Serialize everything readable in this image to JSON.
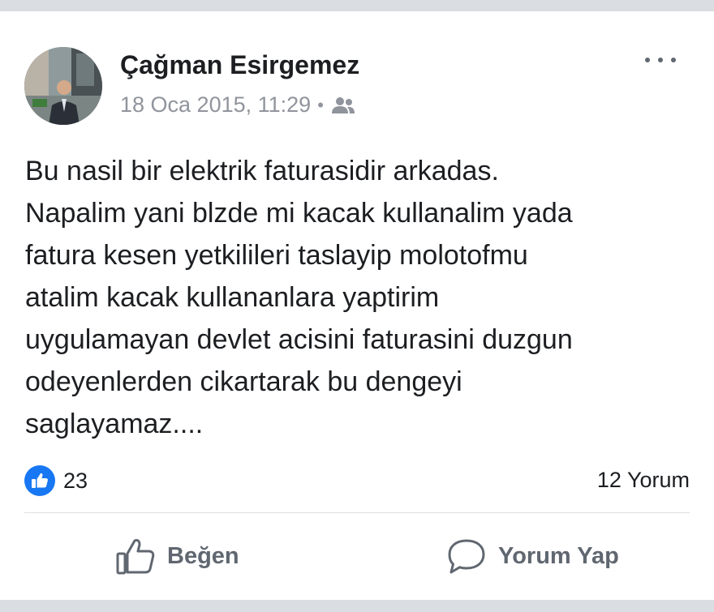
{
  "post": {
    "author": "Çağman Esirgemez",
    "timestamp": "18 Oca 2015, 11:29",
    "separator": "•",
    "privacy_icon": "friends-icon",
    "menu_icon": "more-options-icon",
    "text_lines": [
      "Bu nasil bir elektrik faturasidir arkadas.",
      "Napalim yani blzde mi kacak kullanalim yada",
      "fatura kesen yetkilileri taslayip molotofmu",
      "atalim kacak kullananlara yaptirim",
      "uygulamayan devlet acisini faturasini duzgun",
      "odeyenlerden cikartarak bu dengeyi",
      "saglayamaz...."
    ]
  },
  "stats": {
    "likes": "23",
    "comments": "12 Yorum"
  },
  "actions": {
    "like_label": "Beğen",
    "comment_label": "Yorum Yap"
  },
  "colors": {
    "accent": "#1877f2",
    "muted_text": "#90949c",
    "action_text": "#606770",
    "background": "#dadde1"
  }
}
